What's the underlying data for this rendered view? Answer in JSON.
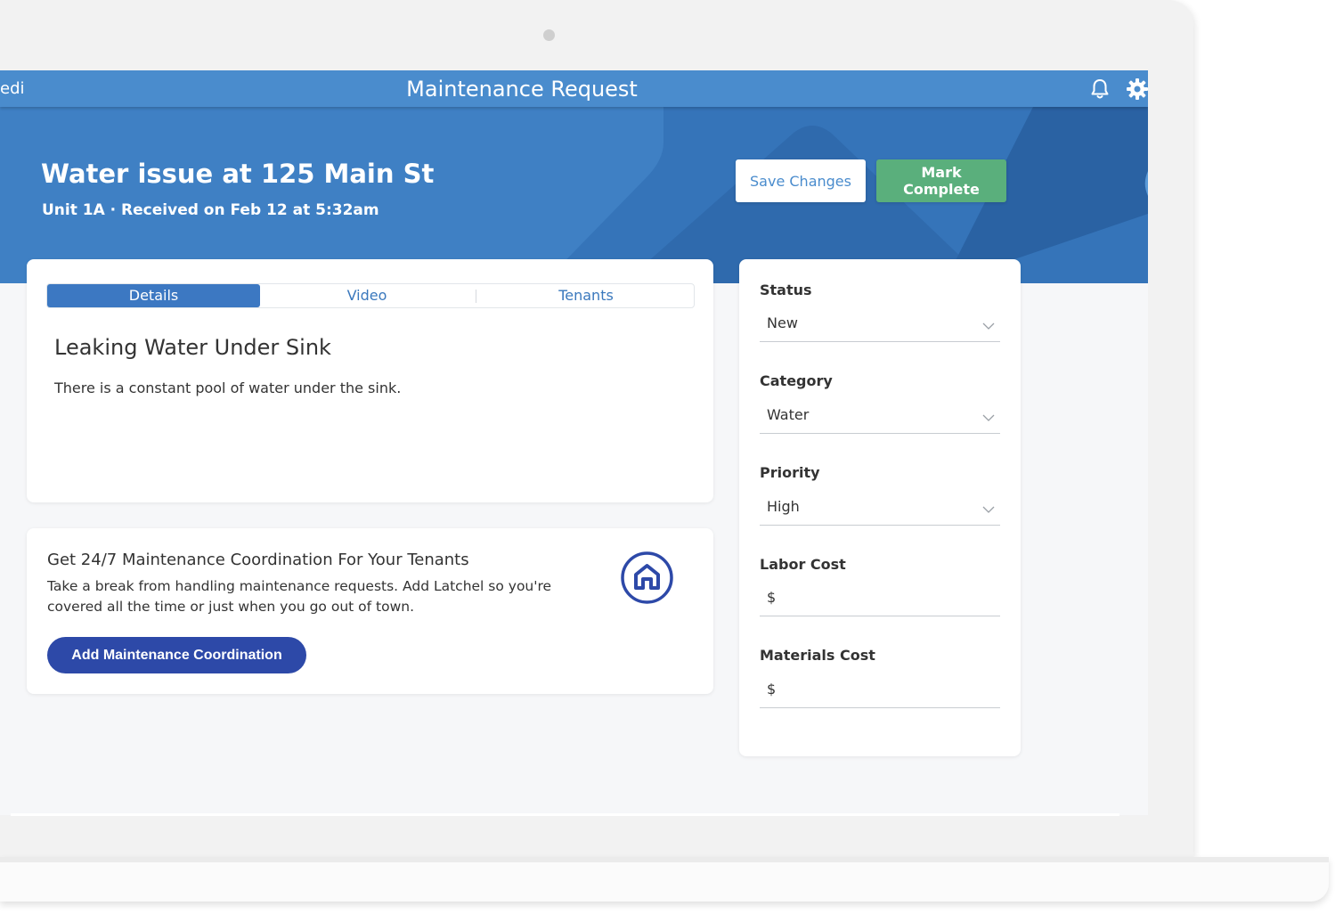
{
  "header": {
    "brand": "edi",
    "title": "Maintenance Request"
  },
  "hero": {
    "title": "Water issue at 125 Main St",
    "subtitle": "Unit 1A · Received on Feb 12 at 5:32am",
    "save_label": "Save Changes",
    "complete_label": "Mark Complete"
  },
  "tabs": [
    {
      "label": "Details",
      "active": true
    },
    {
      "label": "Video",
      "active": false
    },
    {
      "label": "Tenants",
      "active": false
    }
  ],
  "request": {
    "title": "Leaking Water Under Sink",
    "description": "There is a constant pool of water under the sink."
  },
  "promo": {
    "title": "Get 24/7 Maintenance Coordination For Your Tenants",
    "text": "Take a break from handling maintenance requests. Add Latchel so you're covered all the time or just when you go out of town.",
    "button_label": "Add Maintenance Coordination",
    "icon": "house-icon"
  },
  "fields": {
    "status": {
      "label": "Status",
      "value": "New"
    },
    "category": {
      "label": "Category",
      "value": "Water"
    },
    "priority": {
      "label": "Priority",
      "value": "High"
    },
    "labor_cost": {
      "label": "Labor Cost",
      "value": "$"
    },
    "materials_cost": {
      "label": "Materials Cost",
      "value": "$"
    }
  },
  "colors": {
    "primary": "#4a8ccd",
    "hero": "#3f80c4",
    "success": "#5aaf7c",
    "promo_button": "#2d49a8"
  }
}
